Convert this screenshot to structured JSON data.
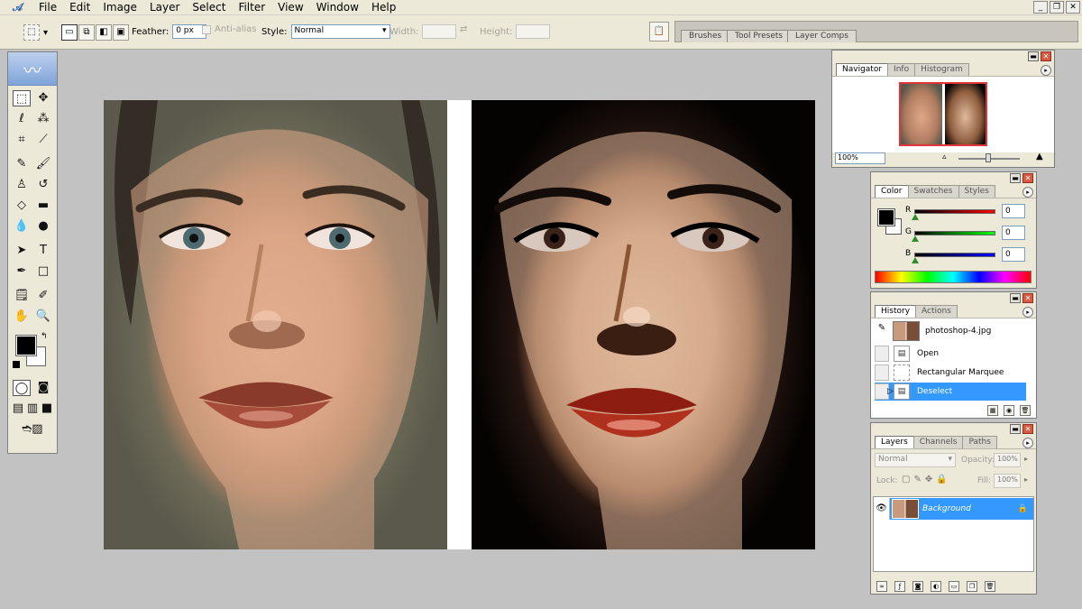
{
  "menu": {
    "items": [
      "File",
      "Edit",
      "Image",
      "Layer",
      "Select",
      "Filter",
      "View",
      "Window",
      "Help"
    ],
    "window_controls": [
      "_",
      "❐",
      "✕"
    ]
  },
  "options": {
    "feather_label": "Feather:",
    "feather_value": "0 px",
    "antialias_label": "Anti-alias",
    "style_label": "Style:",
    "style_value": "Normal",
    "width_label": "Width:",
    "height_label": "Height:"
  },
  "palette_well": {
    "tabs": [
      "Brushes",
      "Tool Presets",
      "Layer Comps"
    ]
  },
  "navigator": {
    "tabs": [
      "Navigator",
      "Info",
      "Histogram"
    ],
    "zoom": "100%"
  },
  "color": {
    "tabs": [
      "Color",
      "Swatches",
      "Styles"
    ],
    "channels": [
      {
        "label": "R",
        "value": "0"
      },
      {
        "label": "G",
        "value": "0"
      },
      {
        "label": "B",
        "value": "0"
      }
    ]
  },
  "history": {
    "tabs": [
      "History",
      "Actions"
    ],
    "snapshot": "photoshop-4.jpg",
    "states": [
      "Open",
      "Rectangular Marquee",
      "Deselect"
    ]
  },
  "layers": {
    "tabs": [
      "Layers",
      "Channels",
      "Paths"
    ],
    "blend_mode": "Normal",
    "opacity_label": "Opacity:",
    "opacity_value": "100%",
    "lock_label": "Lock:",
    "fill_label": "Fill:",
    "fill_value": "100%",
    "layer_name": "Background"
  },
  "colors": {
    "selection": "#3399ff",
    "panel_bg": "#ece9d8",
    "workspace": "#c2c2c2"
  }
}
